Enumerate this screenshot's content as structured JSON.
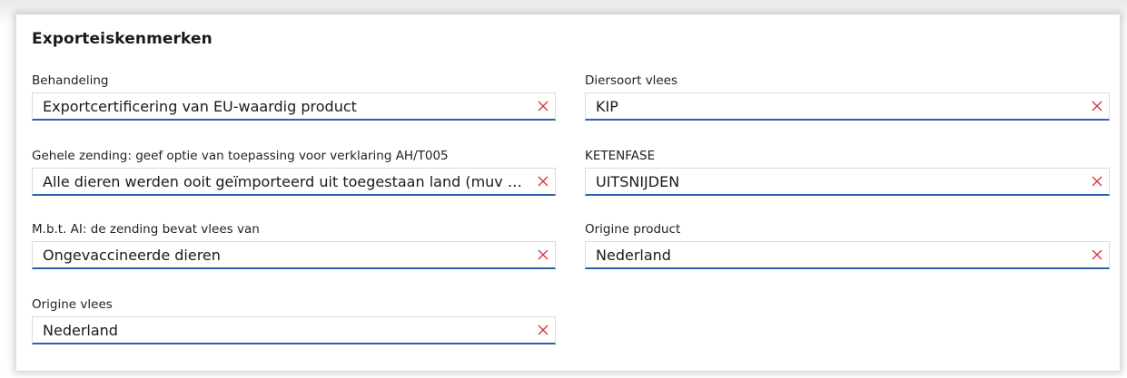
{
  "panel": {
    "title": "Exporteiskenmerken"
  },
  "fields": {
    "behandeling": {
      "label": "Behandeling",
      "value": "Exportcertificering van EU-waardig product"
    },
    "diersoort": {
      "label": "Diersoort vlees",
      "value": "KIP"
    },
    "gehele_zending": {
      "label": "Gehele zending: geef optie van toepassing voor verklaring AH/T005",
      "value": "Alle dieren werden ooit geïmporteerd uit toegestaan land  (muv uitzonderingen)"
    },
    "ketenfase": {
      "label": "KETENFASE",
      "value": "UITSNIJDEN"
    },
    "mbt_ai": {
      "label": "M.b.t. AI: de zending bevat vlees van",
      "value": "Ongevaccineerde dieren"
    },
    "origine_product": {
      "label": "Origine product",
      "value": "Nederland"
    },
    "origine_vlees": {
      "label": "Origine vlees",
      "value": "Nederland"
    }
  },
  "icons": {
    "clear": "close-icon"
  },
  "colors": {
    "underline": "#2e62a8",
    "clear_icon": "#d9363e",
    "border": "#dcdcdc"
  }
}
